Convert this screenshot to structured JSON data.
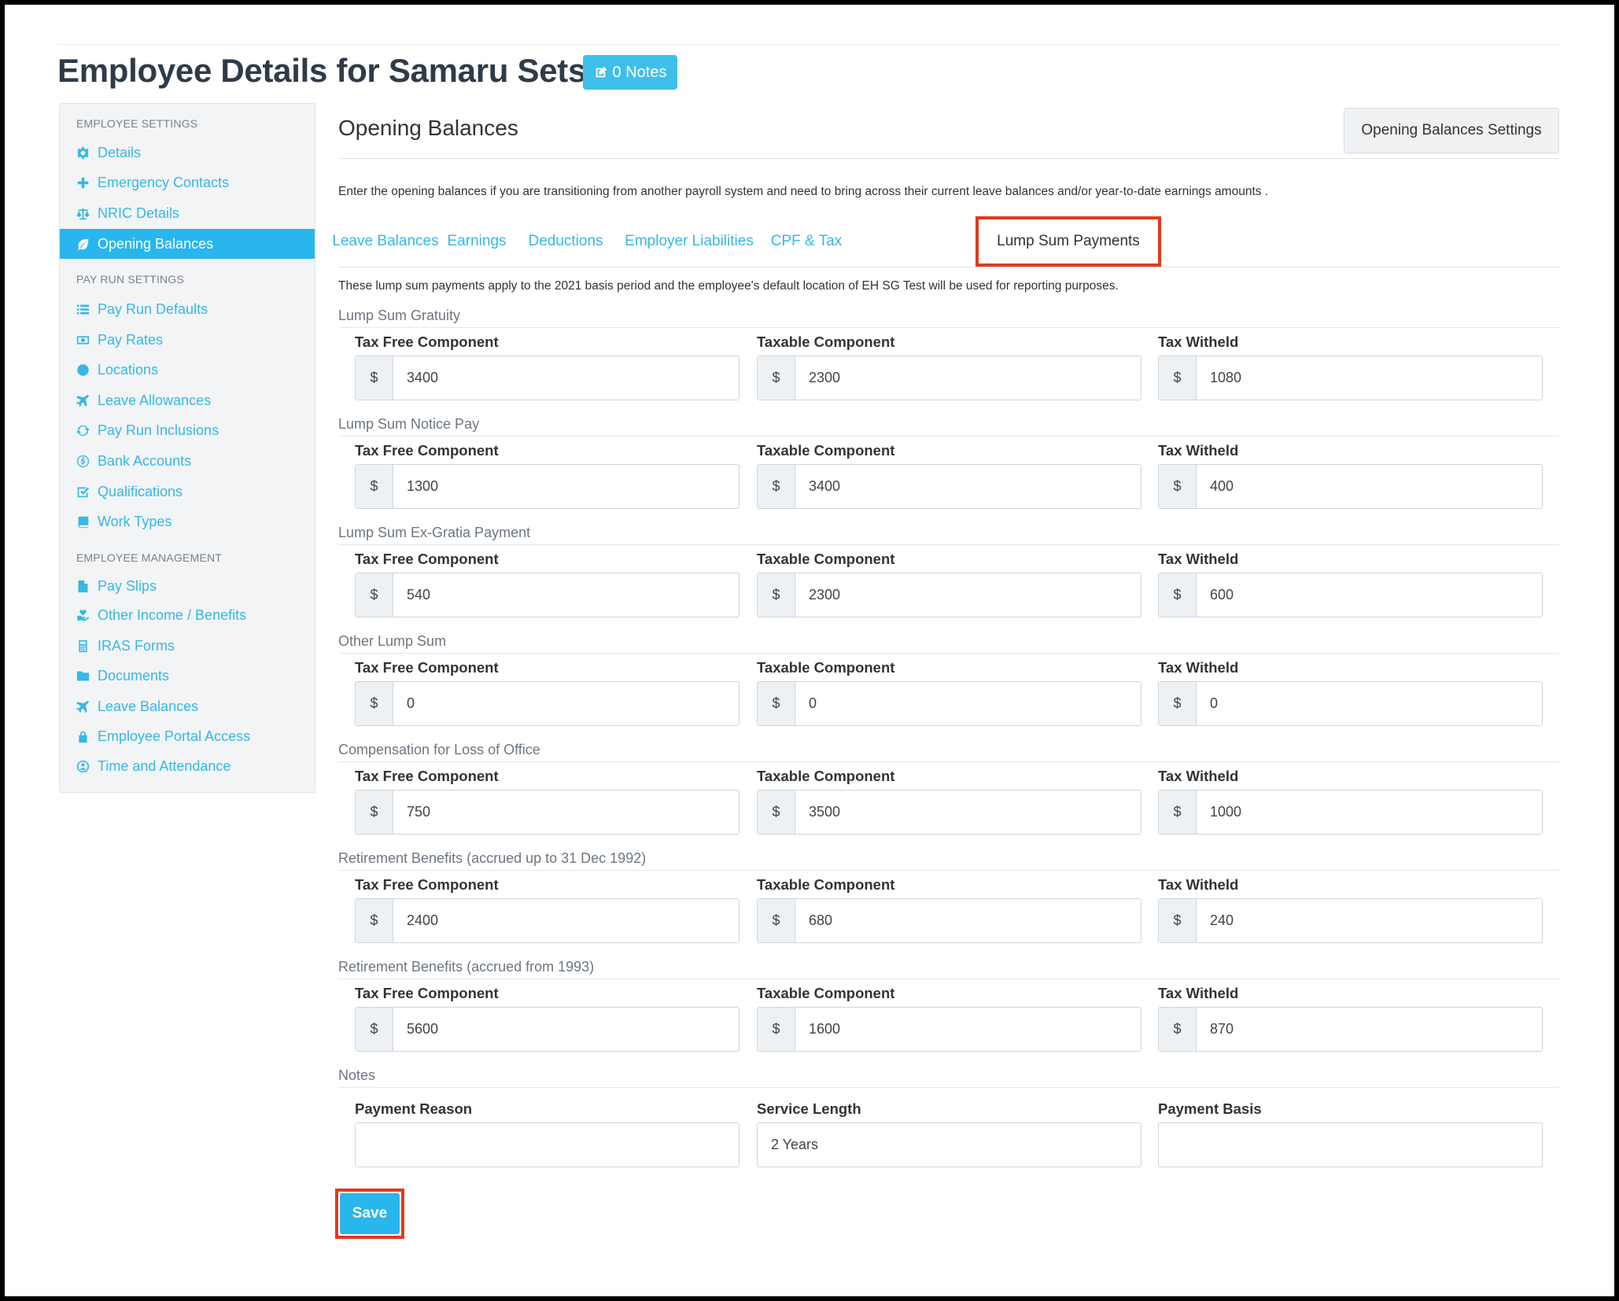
{
  "page": {
    "title": "Employee Details for Samaru Setsu",
    "notes_button": "0 Notes"
  },
  "sidebar": {
    "sections": [
      {
        "label": "EMPLOYEE SETTINGS",
        "items": [
          {
            "label": "Details",
            "icon": "gear-icon"
          },
          {
            "label": "Emergency Contacts",
            "icon": "plus-icon"
          },
          {
            "label": "NRIC Details",
            "icon": "scale-icon"
          },
          {
            "label": "Opening Balances",
            "icon": "leaf-icon",
            "active": true
          }
        ]
      },
      {
        "label": "PAY RUN SETTINGS",
        "items": [
          {
            "label": "Pay Run Defaults",
            "icon": "list-icon"
          },
          {
            "label": "Pay Rates",
            "icon": "money-icon"
          },
          {
            "label": "Locations",
            "icon": "globe-icon"
          },
          {
            "label": "Leave Allowances",
            "icon": "plane-icon"
          },
          {
            "label": "Pay Run Inclusions",
            "icon": "refresh-icon"
          },
          {
            "label": "Bank Accounts",
            "icon": "dollar-circle-icon"
          },
          {
            "label": "Qualifications",
            "icon": "check-square-icon"
          },
          {
            "label": "Work Types",
            "icon": "book-icon"
          }
        ]
      },
      {
        "label": "EMPLOYEE MANAGEMENT",
        "items": [
          {
            "label": "Pay Slips",
            "icon": "file-icon"
          },
          {
            "label": "Other Income / Benefits",
            "icon": "hand-heart-icon"
          },
          {
            "label": "IRAS Forms",
            "icon": "calculator-icon"
          },
          {
            "label": "Documents",
            "icon": "folder-icon"
          },
          {
            "label": "Leave Balances",
            "icon": "plane-icon"
          },
          {
            "label": "Employee Portal Access",
            "icon": "lock-icon"
          },
          {
            "label": "Time and Attendance",
            "icon": "clock-user-icon"
          }
        ]
      }
    ]
  },
  "main": {
    "heading": "Opening Balances",
    "settings_button": "Opening Balances Settings",
    "intro": "Enter the opening balances if you are transitioning from another payroll system and need to bring across their current leave balances and/or year-to-date earnings amounts .",
    "tabs": [
      "Leave Balances",
      "Earnings",
      "Deductions",
      "Employer Liabilities",
      "CPF & Tax",
      "Lump Sum Payments"
    ],
    "active_tab": "Lump Sum Payments",
    "hint": "These lump sum payments apply to the 2021 basis period and the employee's default location of EH SG Test will be used for reporting purposes.",
    "currency_symbol": "$",
    "field_labels": [
      "Tax Free Component",
      "Taxable Component",
      "Tax Witheld"
    ],
    "groups": [
      {
        "title": "Lump Sum Gratuity",
        "values": [
          "3400",
          "2300",
          "1080"
        ]
      },
      {
        "title": "Lump Sum Notice Pay",
        "values": [
          "1300",
          "3400",
          "400"
        ]
      },
      {
        "title": "Lump Sum Ex-Gratia Payment",
        "values": [
          "540",
          "2300",
          "600"
        ]
      },
      {
        "title": "Other Lump Sum",
        "values": [
          "0",
          "0",
          "0"
        ]
      },
      {
        "title": "Compensation for Loss of Office",
        "values": [
          "750",
          "3500",
          "1000"
        ]
      },
      {
        "title": "Retirement Benefits (accrued up to 31 Dec 1992)",
        "values": [
          "2400",
          "680",
          "240"
        ]
      },
      {
        "title": "Retirement Benefits (accrued from 1993)",
        "values": [
          "5600",
          "1600",
          "870"
        ]
      }
    ],
    "notes": {
      "title": "Notes",
      "fields": [
        {
          "label": "Payment Reason",
          "value": ""
        },
        {
          "label": "Service Length",
          "value": "2 Years"
        },
        {
          "label": "Payment Basis",
          "value": ""
        }
      ]
    },
    "save_button": "Save"
  },
  "colors": {
    "accent": "#29b6ec",
    "highlight_border": "#e03a1f",
    "title": "#2f3b48"
  }
}
